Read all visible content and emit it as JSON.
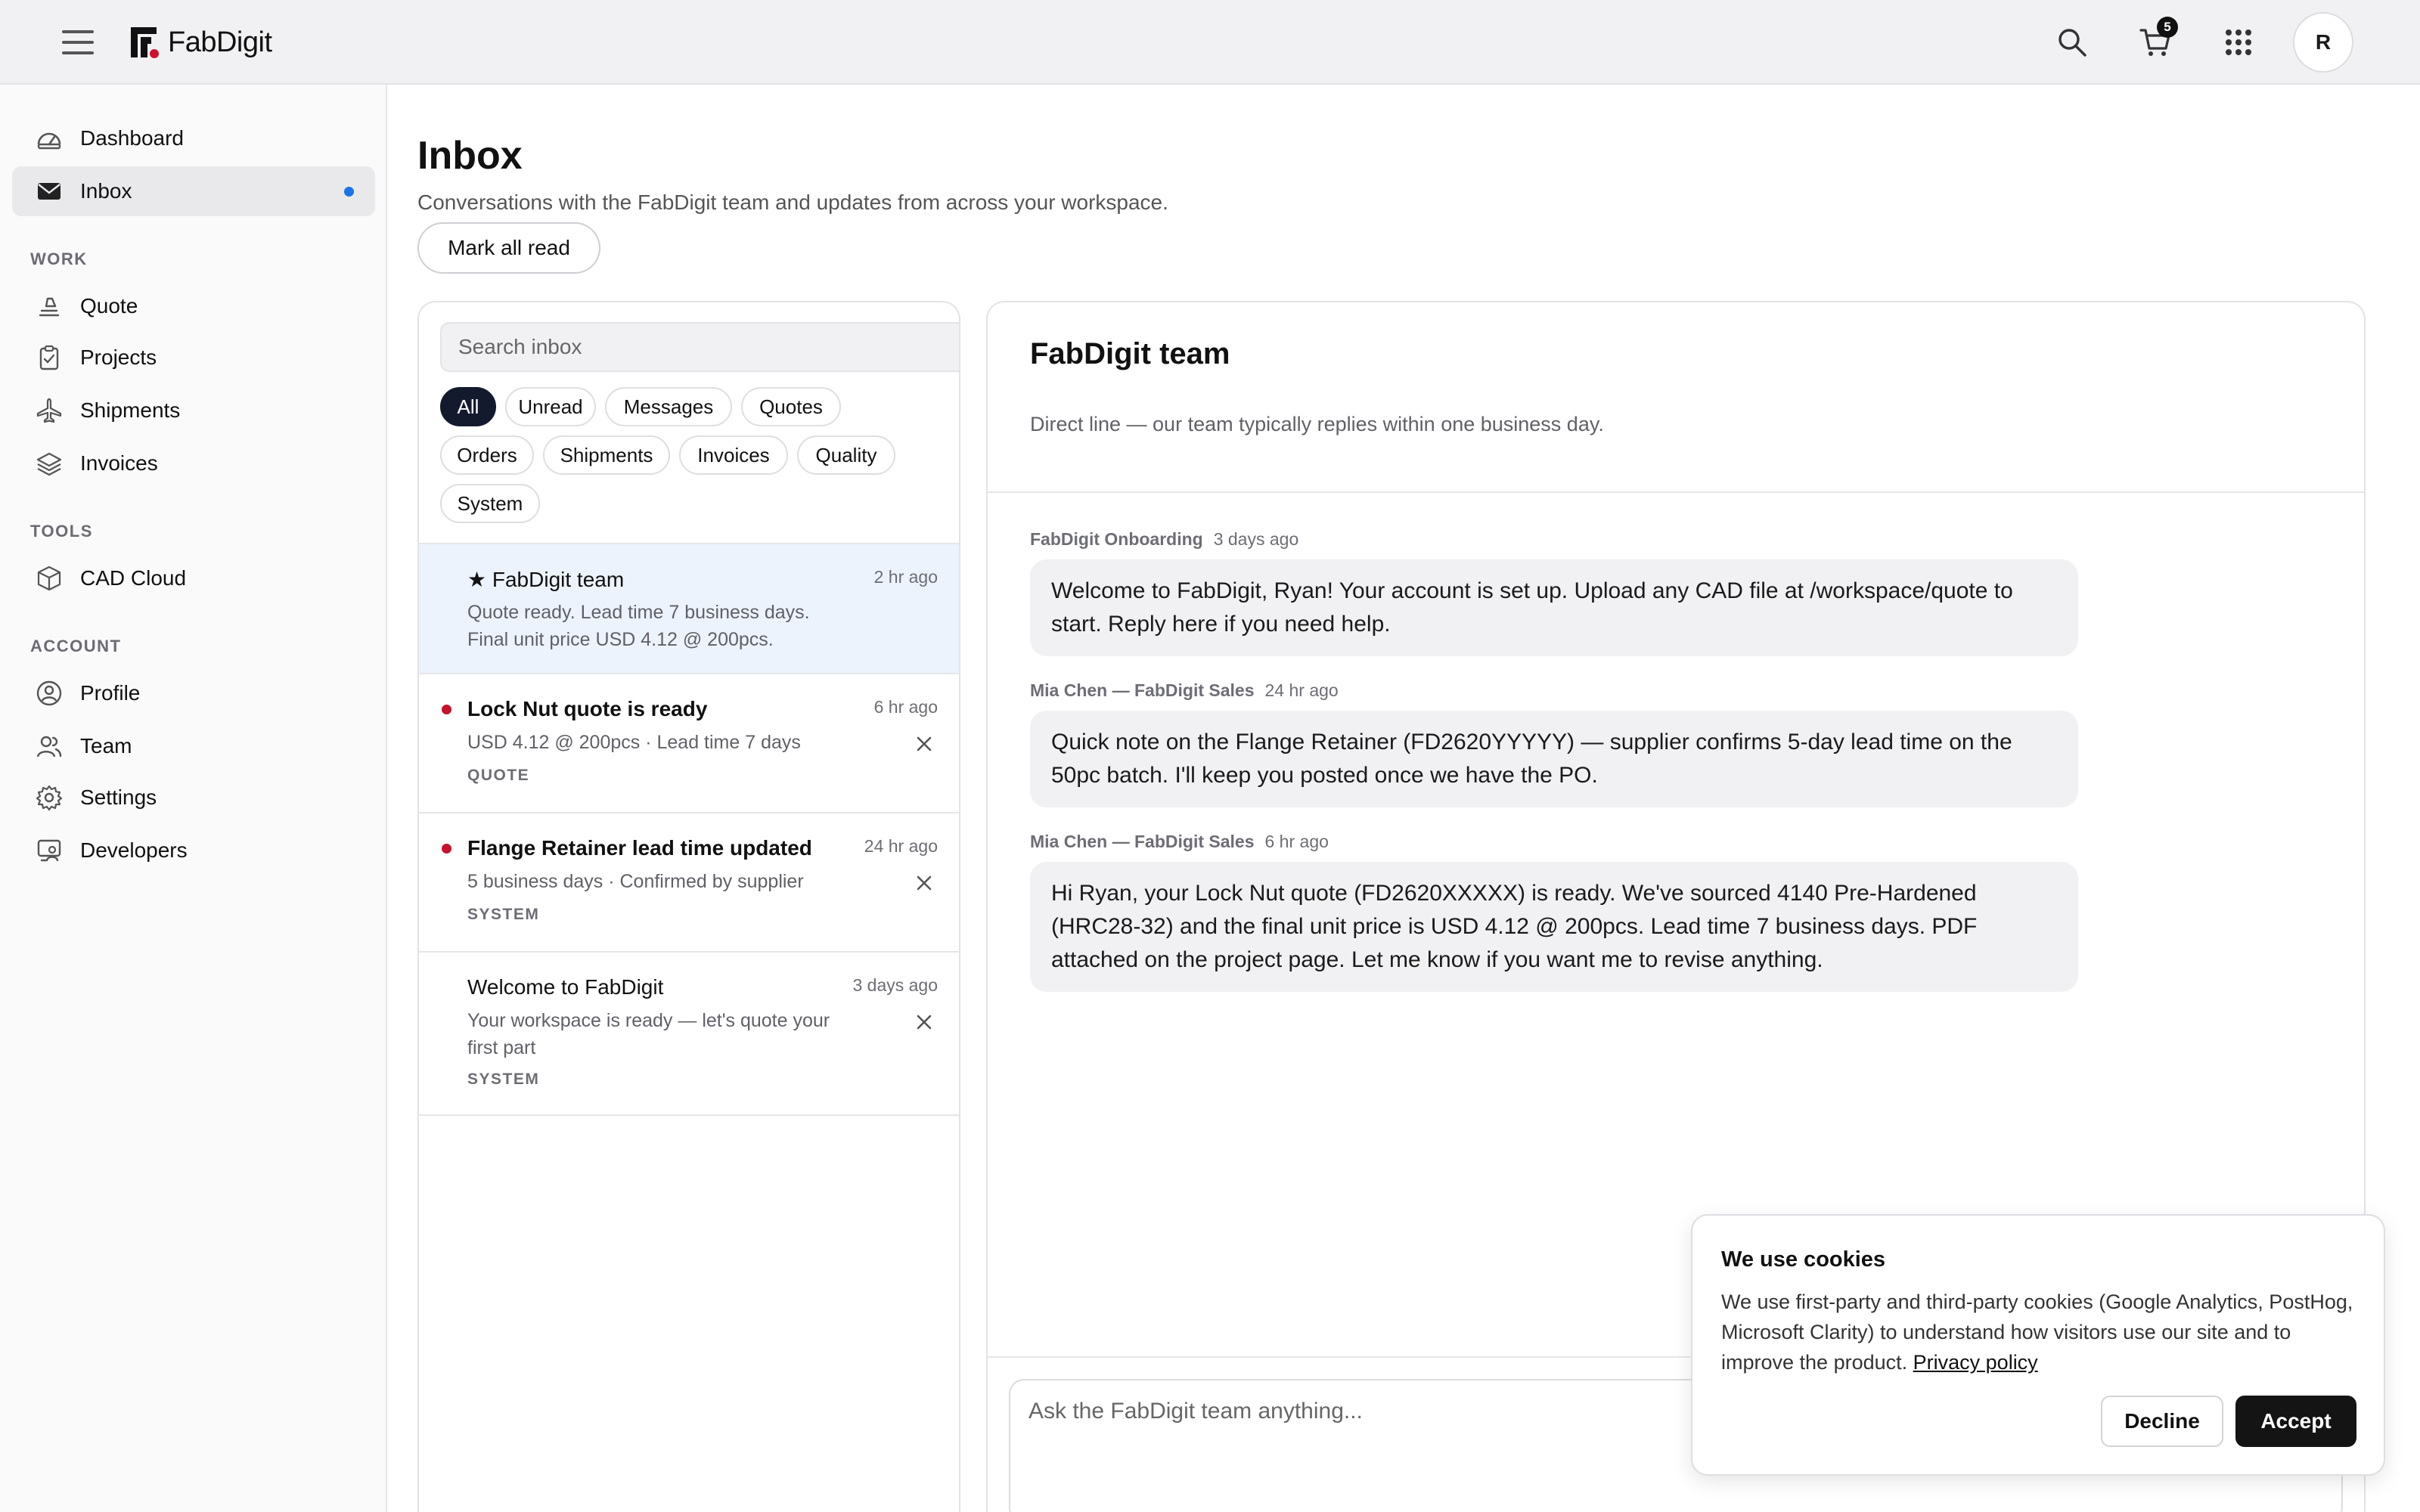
{
  "brand": {
    "name": "FabDigit",
    "accent": "#d0112b"
  },
  "header": {
    "cart_count": "5",
    "avatar_initial": "R"
  },
  "sidebar": {
    "items": [
      {
        "label": "Dashboard",
        "icon": "dashboard-icon"
      },
      {
        "label": "Inbox",
        "icon": "mail-icon",
        "active": true,
        "unread_indicator": true
      }
    ],
    "sections": [
      {
        "title": "WORK",
        "items": [
          {
            "label": "Quote",
            "icon": "quote-icon"
          },
          {
            "label": "Projects",
            "icon": "clipboard-icon"
          },
          {
            "label": "Shipments",
            "icon": "plane-icon"
          },
          {
            "label": "Invoices",
            "icon": "layers-icon"
          }
        ]
      },
      {
        "title": "TOOLS",
        "items": [
          {
            "label": "CAD Cloud",
            "icon": "cube-icon"
          }
        ]
      },
      {
        "title": "ACCOUNT",
        "items": [
          {
            "label": "Profile",
            "icon": "user-circle-icon"
          },
          {
            "label": "Team",
            "icon": "team-icon"
          },
          {
            "label": "Settings",
            "icon": "gear-icon"
          },
          {
            "label": "Developers",
            "icon": "developer-icon"
          }
        ]
      }
    ]
  },
  "page": {
    "title": "Inbox",
    "subtitle": "Conversations with the FabDigit team and updates from across your workspace.",
    "mark_all_read": "Mark all read"
  },
  "inbox": {
    "search_placeholder": "Search inbox",
    "filters": [
      "All",
      "Unread",
      "Messages",
      "Quotes",
      "Orders",
      "Shipments",
      "Invoices",
      "Quality",
      "System"
    ],
    "active_filter": "All",
    "conversations": [
      {
        "title": "★ FabDigit team",
        "time": "2 hr ago",
        "preview": "Quote ready. Lead time 7 business days. Final unit price USD 4.12 @ 200pcs.",
        "tag": "",
        "unread": false,
        "selected": true
      },
      {
        "title": "Lock Nut quote is ready",
        "time": "6 hr ago",
        "preview": "USD 4.12 @ 200pcs · Lead time 7 days",
        "tag": "QUOTE",
        "unread": true
      },
      {
        "title": "Flange Retainer lead time updated",
        "time": "24 hr ago",
        "preview": "5 business days · Confirmed by supplier",
        "tag": "SYSTEM",
        "unread": true
      },
      {
        "title": "Welcome to FabDigit",
        "time": "3 days ago",
        "preview": "Your workspace is ready — let's quote your first part",
        "tag": "SYSTEM",
        "unread": false
      }
    ]
  },
  "chat": {
    "title": "FabDigit team",
    "subtitle": "Direct line — our team typically replies within one business day.",
    "messages": [
      {
        "author": "FabDigit Onboarding",
        "time": "3 days ago",
        "text": "Welcome to FabDigit, Ryan! Your account is set up. Upload any CAD file at /workspace/quote to start. Reply here if you need help."
      },
      {
        "author": "Mia Chen — FabDigit Sales",
        "time": "24 hr ago",
        "text": "Quick note on the Flange Retainer (FD2620YYYYY) — supplier confirms 5-day lead time on the 50pc batch. I'll keep you posted once we have the PO."
      },
      {
        "author": "Mia Chen — FabDigit Sales",
        "time": "6 hr ago",
        "text": "Hi Ryan, your Lock Nut quote (FD2620XXXXX) is ready. We've sourced 4140 Pre-Hardened (HRC28-32) and the final unit price is USD 4.12 @ 200pcs. Lead time 7 business days. PDF attached on the project page. Let me know if you want me to revise anything."
      }
    ],
    "composer_placeholder": "Ask the FabDigit team anything..."
  },
  "cookie_banner": {
    "title": "We use cookies",
    "text": "We use first-party and third-party cookies (Google Analytics, PostHog, Microsoft Clarity) to understand how visitors use our site and to improve the product.",
    "link": "Privacy policy",
    "decline": "Decline",
    "accept": "Accept"
  }
}
